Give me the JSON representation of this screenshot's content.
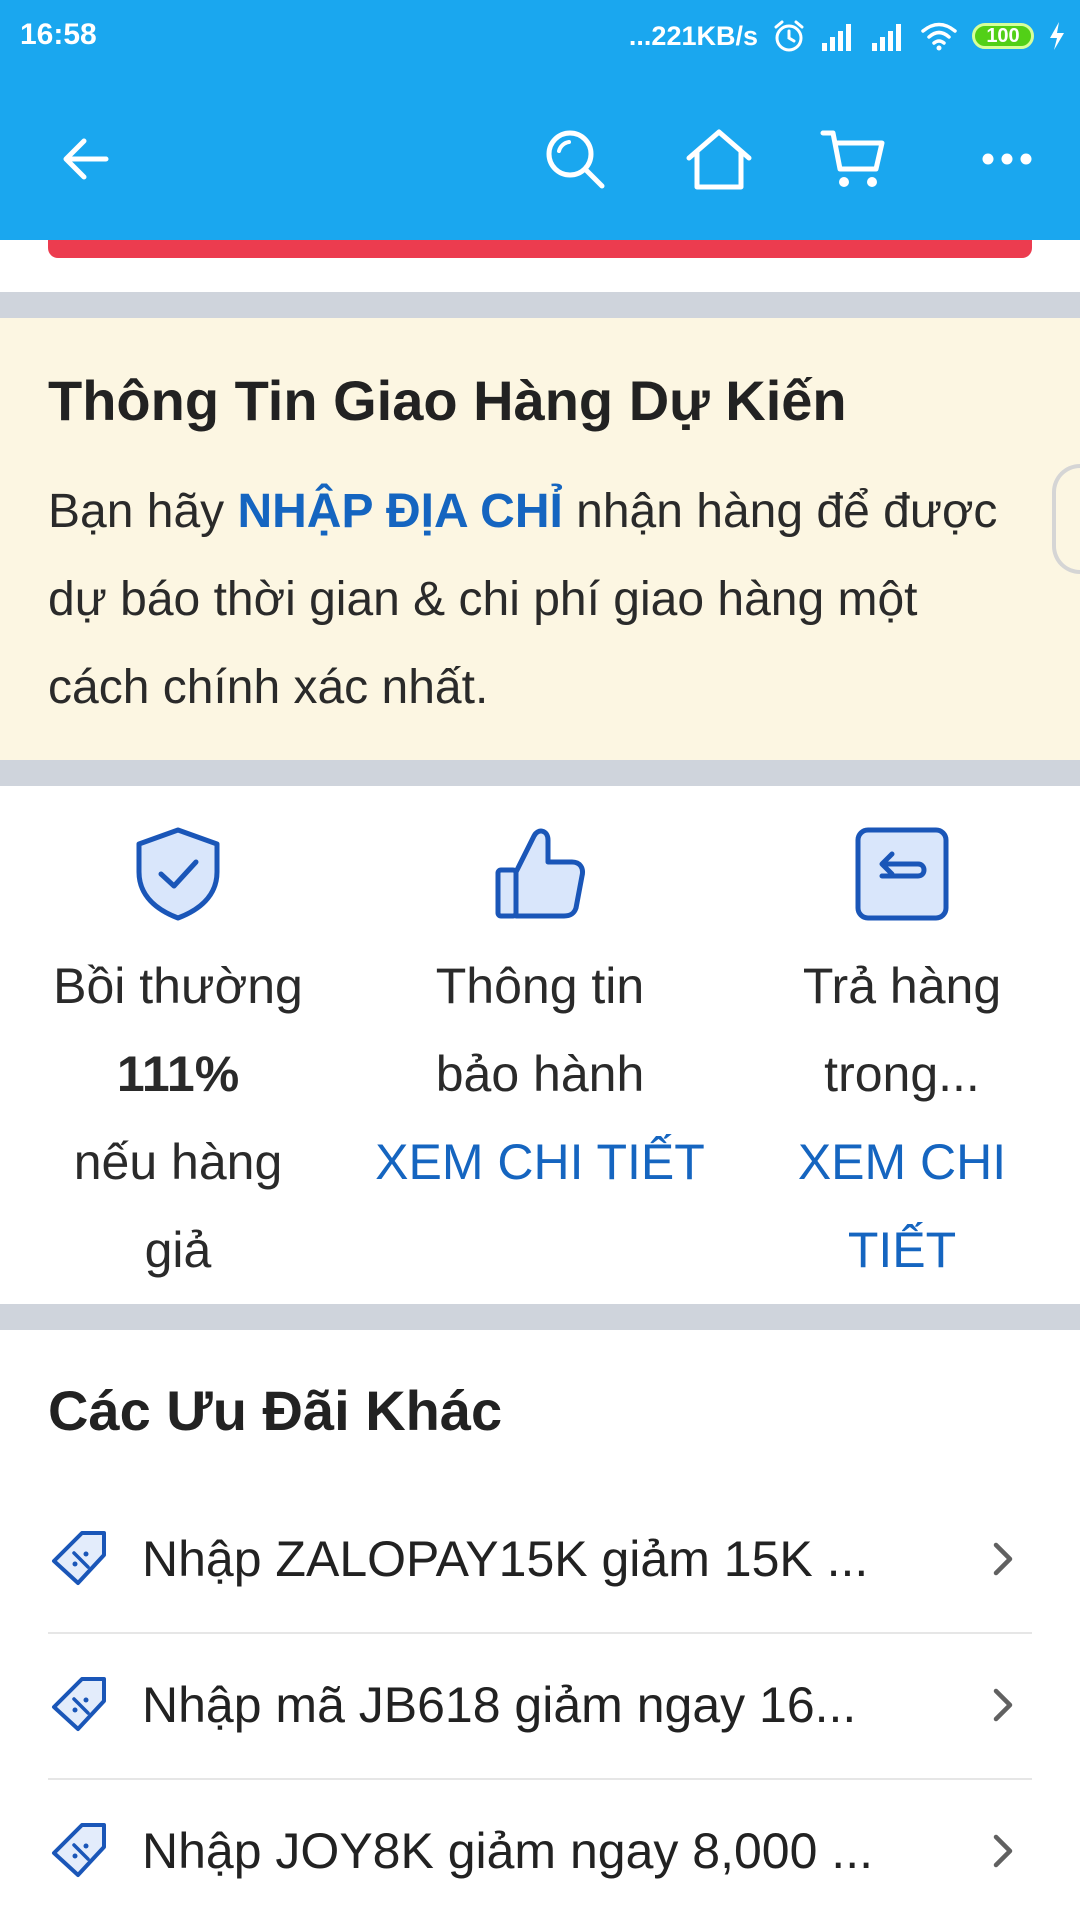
{
  "status_bar": {
    "time": "16:58",
    "network_speed": "...221KB/s",
    "battery": "100"
  },
  "toolbar": {
    "back_icon": "arrow-left-icon",
    "search_icon": "search-icon",
    "home_icon": "home-icon",
    "cart_icon": "cart-icon",
    "more_icon": "more-icon"
  },
  "delivery": {
    "title": "Thông Tin Giao Hàng Dự Kiến",
    "text_before": "Bạn hãy ",
    "link": "NHẬP ĐỊA CHỈ",
    "text_after": " nhận hàng để được dự báo thời gian & chi phí giao hàng một cách chính xác nhất."
  },
  "features": [
    {
      "icon": "shield-check-icon",
      "line1": "Bồi thường",
      "bold": "111%",
      "line3": "nếu hàng giả"
    },
    {
      "icon": "thumbs-up-icon",
      "text": "Thông tin bảo hành",
      "link": "XEM CHI TIẾT"
    },
    {
      "icon": "return-icon",
      "text": "Trả hàng trong...",
      "link": "XEM CHI TIẾT"
    }
  ],
  "offers": {
    "title": "Các Ưu Đãi Khác",
    "items": [
      {
        "icon": "coupon-icon",
        "label": "Nhập ZALOPAY15K giảm 15K ..."
      },
      {
        "icon": "coupon-icon",
        "label": "Nhập mã JB618 giảm ngay 16..."
      },
      {
        "icon": "coupon-icon",
        "label": "Nhập JOY8K giảm ngay 8,000 ..."
      }
    ]
  },
  "colors": {
    "header": "#1aa7ef",
    "link": "#1565c0",
    "delivery_bg": "#fcf6e2",
    "red_strip": "#ec3c4f"
  }
}
